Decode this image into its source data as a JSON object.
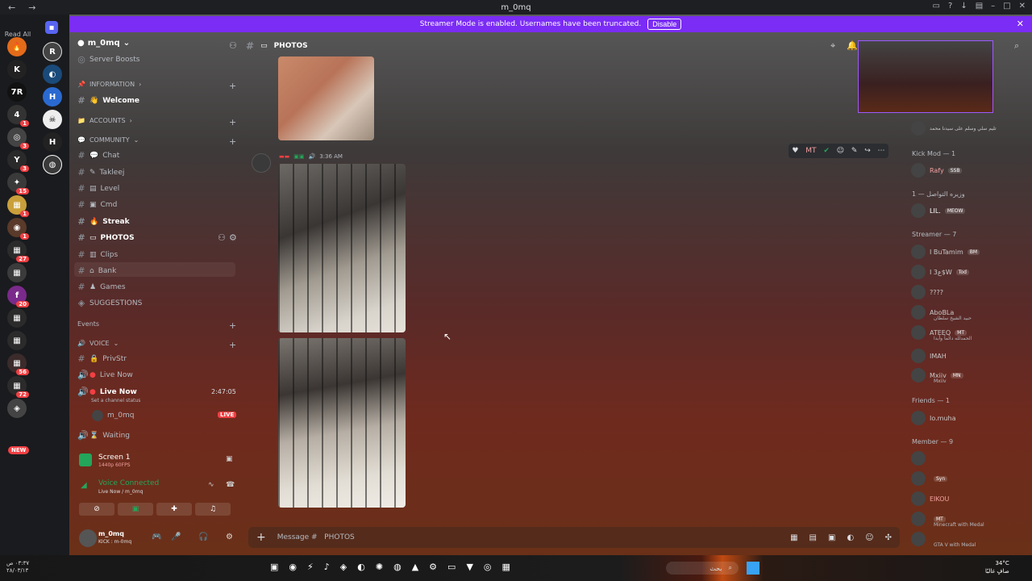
{
  "window": {
    "title": "m_0mq"
  },
  "banner": {
    "text": "Streamer Mode is enabled. Usernames have been truncated.",
    "disable": "Disable"
  },
  "rail": {
    "read_all": "Read All",
    "new": "NEW",
    "badges": [
      "1",
      "3",
      "3",
      "15",
      "1",
      "1",
      "27",
      "20",
      "56",
      "72"
    ]
  },
  "server": {
    "name": "m_0mq"
  },
  "sidebar": {
    "server_boosts": "Server Boosts",
    "cat_information": "INFORMATION",
    "welcome": "Welcome",
    "cat_accounts": "ACCOUNTS",
    "cat_community": "COMMUNITY",
    "channels": [
      "Chat",
      "Takleej",
      "Level",
      "Cmd",
      "Streak",
      "PHOTOS",
      "Clips",
      "Bank",
      "Games"
    ],
    "suggestions": "SUGGESTIONS",
    "events": "Events",
    "cat_voice": "VOICE",
    "voice_channels": [
      "PrivStr",
      "Live Now",
      "Live Now"
    ],
    "timer": "2:47:05",
    "status_hint": "Set a channel status",
    "voice_user": "m_0mq",
    "live": "LIVE",
    "waiting": "Waiting"
  },
  "screen_panel": {
    "title": "Screen 1",
    "sub": "1440p 60FPS"
  },
  "voice_panel": {
    "title": "Voice Connected",
    "sub": "Live Now / m_0mq"
  },
  "user_panel": {
    "name": "m_0mq",
    "sub": "KICK : m-0mq"
  },
  "chat": {
    "channel": "PHOTOS",
    "time": "3:36 AM",
    "composer_placeholder": "Message #   PHOTOS"
  },
  "members": {
    "kick_mod": "Kick Mod — 1",
    "sec_vip": "وزيره التواصل — 1",
    "streamer": "Streamer — 7",
    "friends": "Friends — 1",
    "member": "Member — 9",
    "rows": [
      {
        "name": "Rafy",
        "tag": "SSB"
      },
      {
        "name": "LIL.",
        "tag": "MEOW"
      },
      {
        "name": "I BuTamim",
        "tag": "BM"
      },
      {
        "name": "I ع3$W",
        "tag": "Tod"
      },
      {
        "name": "????",
        "tag": ""
      },
      {
        "name": "AboBLa",
        "tag": "",
        "sub": "حبيد الشيخ سلطان"
      },
      {
        "name": "ATEEQ",
        "tag": "MT",
        "sub": "الحمدلله دائماً وأبدا"
      },
      {
        "name": "IMAH",
        "tag": ""
      },
      {
        "name": "Mxiiv",
        "tag": "MN",
        "sub": "Mxiiv"
      },
      {
        "name": "Io.muha",
        "tag": ""
      },
      {
        "name": "",
        "tag": "Syn"
      },
      {
        "name": "EIKOU",
        "tag": ""
      },
      {
        "name": "",
        "tag": "MT",
        "sub": "Minecraft with Medal"
      },
      {
        "name": "",
        "tag": "",
        "sub": "GTA V with Medal"
      }
    ],
    "top_sub": "تليم سلي وسلم على سيدنا محمد"
  },
  "taskbar": {
    "time": "٠٣:٣٧ ص",
    "date": "٢٨/٠٣/١٣",
    "search": "بحث",
    "temp": "34°C",
    "weather": "صافٍ غالبًا"
  },
  "colors": {
    "accent": "#7b2cf5",
    "live": "#f23f43"
  }
}
